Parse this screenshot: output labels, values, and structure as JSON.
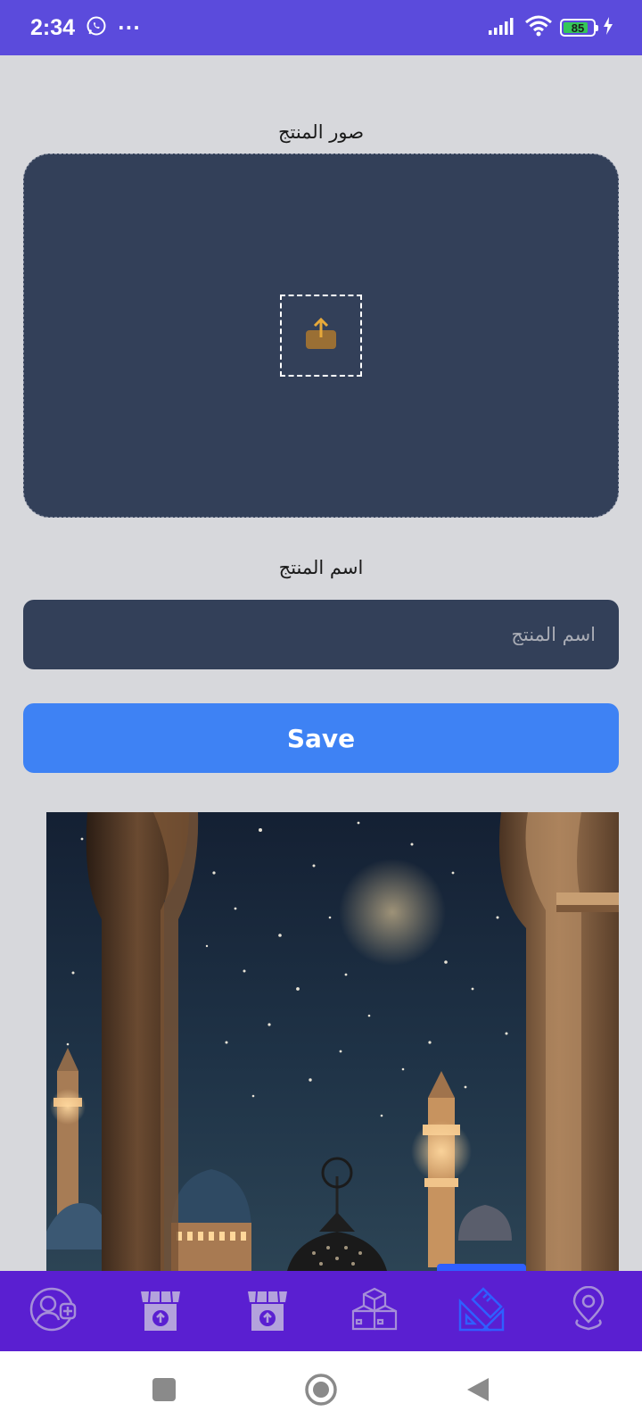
{
  "status_bar": {
    "time": "2:34",
    "more": "···",
    "battery_level": "85",
    "battery_fraction": 0.85
  },
  "form": {
    "images_label": "صور المنتج",
    "name_label": "اسم المنتج",
    "name_placeholder": "اسم المنتج",
    "name_value": "",
    "save_label": "Save"
  },
  "bottom_nav": {
    "items": [
      {
        "icon": "user-add-icon",
        "active": false
      },
      {
        "icon": "store-upload-icon",
        "active": false
      },
      {
        "icon": "store-upload-icon",
        "active": false
      },
      {
        "icon": "boxes-icon",
        "active": false
      },
      {
        "icon": "design-tools-icon",
        "active": true
      },
      {
        "icon": "location-pin-icon",
        "active": false
      }
    ]
  },
  "colors": {
    "status_bar": "#5b4bdc",
    "panel": "#334059",
    "accent": "#3e82f4",
    "nav_bar": "#5a1fd1",
    "nav_active": "#2f5fff",
    "upload_icon": "#c9932e"
  }
}
